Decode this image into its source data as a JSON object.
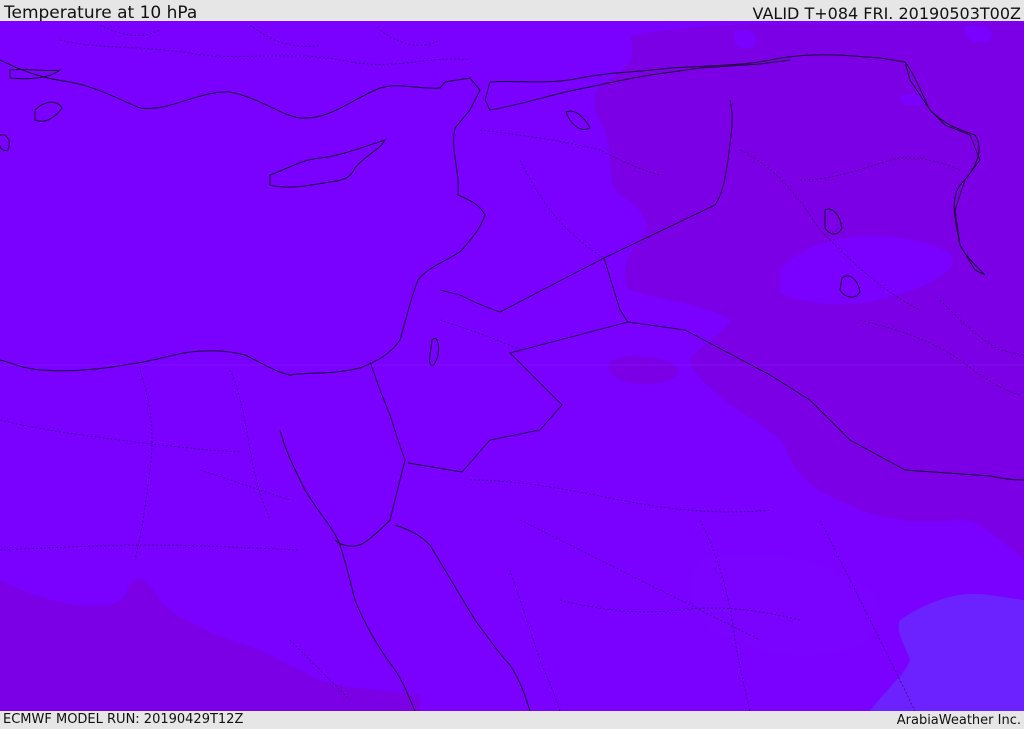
{
  "header": {
    "title": "Temperature at 10 hPa",
    "valid": "VALID T+084 FRI. 20190503T00Z"
  },
  "footer": {
    "model_run": "ECMWF MODEL RUN: 20190429T12Z",
    "credit": "ArabiaWeather Inc."
  },
  "map": {
    "variable": "temperature",
    "level": "10 hPa",
    "colors": {
      "base": "#7a00ff",
      "darker": "#7b00e6",
      "light": "#7a10ff",
      "bluish": "#6b22ff",
      "coast": "#1a0033"
    }
  }
}
